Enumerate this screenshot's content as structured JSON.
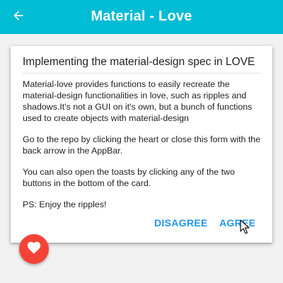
{
  "appbar": {
    "title": "Material - Love",
    "back_icon": "arrow-left-icon",
    "color": "#00bcd4"
  },
  "card": {
    "title": "Implementing the material-design spec in LOVE",
    "paragraphs": [
      "Material-love provides functions to easily recreate the material-design functionalities in love, such as ripples and shadows.It's not a GUI on it's own, but a bunch of functions used to create objects with material-design",
      "Go to the repo by clicking the heart or close this form with the back arrow in the AppBar.",
      "You can also open the toasts by clicking any of the two buttons in the bottom of the card.",
      "PS: Enjoy the ripples!"
    ],
    "actions": {
      "disagree": "DISAGREE",
      "agree": "AGREE"
    },
    "action_color": "#2196f3"
  },
  "fab": {
    "icon": "heart-icon",
    "color": "#f44336"
  },
  "cursor": {
    "icon": "mouse-pointer-icon"
  }
}
